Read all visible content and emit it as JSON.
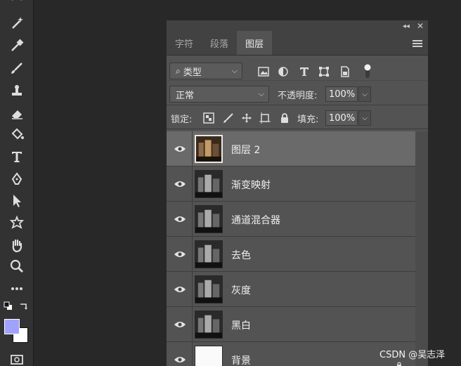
{
  "panel": {
    "tabs": [
      {
        "label": "字符"
      },
      {
        "label": "段落"
      },
      {
        "label": "图层"
      }
    ],
    "filter": {
      "kind_label": "类型"
    },
    "blend": {
      "mode": "正常",
      "opacity_label": "不透明度:",
      "opacity_value": "100%"
    },
    "lock": {
      "label": "锁定:",
      "fill_label": "填充:",
      "fill_value": "100%"
    },
    "layers": [
      {
        "name": "图层 2",
        "selected": true
      },
      {
        "name": "渐变映射"
      },
      {
        "name": "通道混合器"
      },
      {
        "name": "去色"
      },
      {
        "name": "灰度"
      },
      {
        "name": "黑白"
      },
      {
        "name": "背景",
        "locked": true
      }
    ]
  },
  "colors": {
    "foreground": "#a0a2ff",
    "background": "#ffffff"
  },
  "watermark": "CSDN @吴志泽"
}
